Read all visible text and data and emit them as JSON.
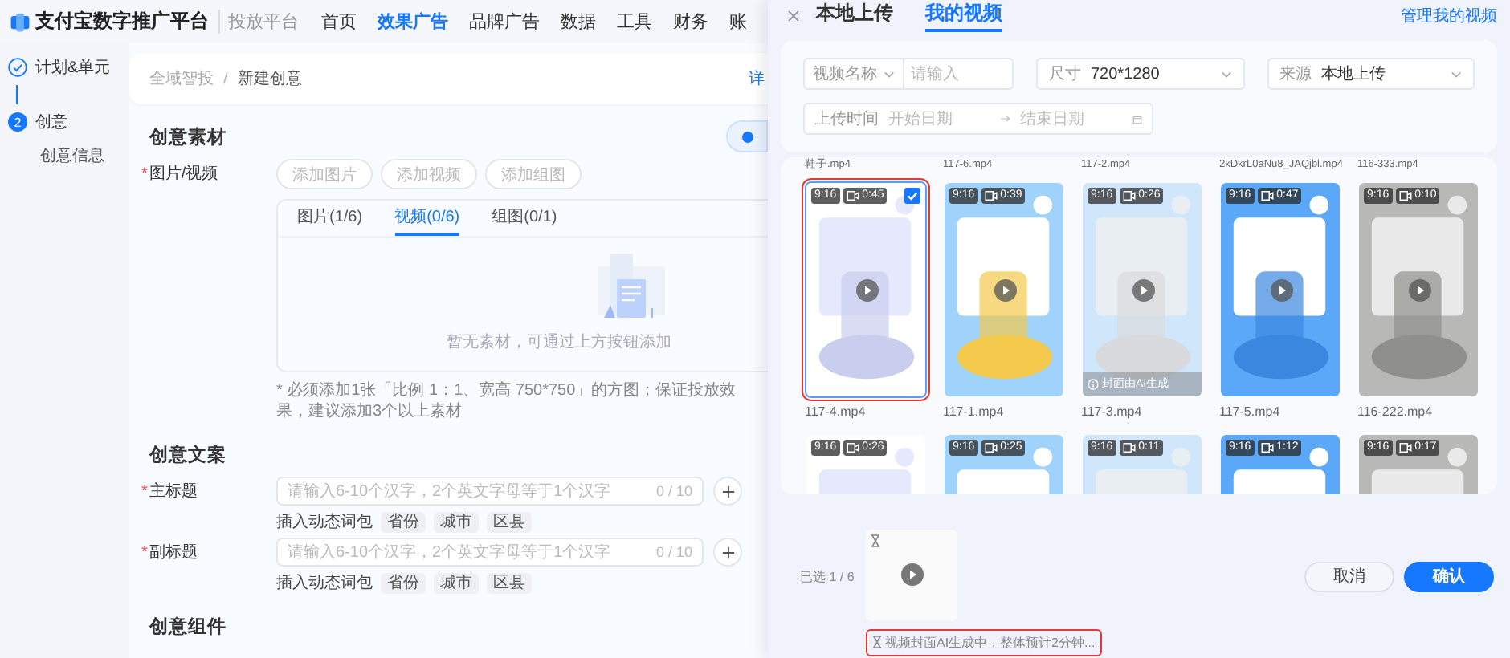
{
  "header": {
    "brand": "支付宝数字推广平台",
    "product": "投放平台",
    "nav": [
      {
        "label": "首页",
        "selected": false
      },
      {
        "label": "效果广告",
        "selected": true
      },
      {
        "label": "品牌广告",
        "selected": false
      },
      {
        "label": "数据",
        "selected": false
      },
      {
        "label": "工具",
        "selected": false
      },
      {
        "label": "财务",
        "selected": false
      },
      {
        "label": "账",
        "selected": false
      }
    ]
  },
  "steps": [
    {
      "label": "计划&单元",
      "done": true
    },
    {
      "number": "2",
      "label": "创意",
      "done": false,
      "children": [
        {
          "label": "创意信息"
        }
      ]
    }
  ],
  "breadcrumb": {
    "items": [
      "全域智投",
      "新建创意"
    ],
    "separator": "/",
    "link": "详"
  },
  "material": {
    "title": "创意素材",
    "label": "图片/视频",
    "required_mark": "*",
    "add_buttons": [
      "添加图片",
      "添加视频",
      "添加组图"
    ],
    "tabs": [
      {
        "label": "图片(1/6)",
        "selected": false
      },
      {
        "label": "视频(0/6)",
        "selected": true
      },
      {
        "label": "组图(0/1)",
        "selected": false
      }
    ],
    "empty_text": "暂无素材，可通过上方按钮添加",
    "note": "* 必须添加1张「比例 1：1、宽高 750*750」的方图；保证投放效果，建议添加3个以上素材"
  },
  "copy": {
    "title": "创意文案",
    "fields": [
      {
        "label": "主标题",
        "required_mark": "*",
        "placeholder": "请输入6-10个汉字，2个英文字母等于1个汉字",
        "counter": "0 / 10",
        "insert_label": "插入动态词包",
        "tags": [
          "省份",
          "城市",
          "区县"
        ]
      },
      {
        "label": "副标题",
        "required_mark": "*",
        "placeholder": "请输入6-10个汉字，2个英文字母等于1个汉字",
        "counter": "0 / 10",
        "insert_label": "插入动态词包",
        "tags": [
          "省份",
          "城市",
          "区县"
        ]
      }
    ]
  },
  "components": {
    "title": "创意组件"
  },
  "drawer": {
    "tabs": [
      {
        "label": "本地上传",
        "selected": false
      },
      {
        "label": "我的视频",
        "selected": true
      }
    ],
    "manage_link": "管理我的视频",
    "filters": {
      "name_select": "视频名称",
      "name_placeholder": "请输入",
      "size_label": "尺寸",
      "size_value": "720*1280",
      "source_label": "来源",
      "source_value": "本地上传",
      "date_label": "上传时间",
      "start_placeholder": "开始日期",
      "end_placeholder": "结束日期"
    },
    "prev_row_names": [
      "鞋子.mp4",
      "117-6.mp4",
      "117-2.mp4",
      "2kDkrL0aNu8_JAQjbl.mp4",
      "116-333.mp4"
    ],
    "videos": [
      {
        "ratio": "9:16",
        "duration": "0:45",
        "name": "117-4.mp4",
        "selected": true,
        "highlighted": true
      },
      {
        "ratio": "9:16",
        "duration": "0:39",
        "name": "117-1.mp4",
        "selected": false,
        "highlighted": false
      },
      {
        "ratio": "9:16",
        "duration": "0:26",
        "name": "117-3.mp4",
        "selected": false,
        "highlighted": false,
        "cover_note": "封面由AI生成"
      },
      {
        "ratio": "9:16",
        "duration": "0:47",
        "name": "117-5.mp4",
        "selected": false,
        "highlighted": false
      },
      {
        "ratio": "9:16",
        "duration": "0:10",
        "name": "116-222.mp4",
        "selected": false,
        "highlighted": false
      },
      {
        "ratio": "9:16",
        "duration": "0:26",
        "selected": false,
        "highlighted": false
      },
      {
        "ratio": "9:16",
        "duration": "0:25",
        "selected": false,
        "highlighted": false
      },
      {
        "ratio": "9:16",
        "duration": "0:11",
        "selected": false,
        "highlighted": false
      },
      {
        "ratio": "9:16",
        "duration": "1:12",
        "selected": false,
        "highlighted": false
      },
      {
        "ratio": "9:16",
        "duration": "0:17",
        "selected": false,
        "highlighted": false
      }
    ],
    "selected_count": "已选 1 / 6",
    "status": {
      "text": "视频封面AI生成中，整体预计2分钟...",
      "highlighted": true
    },
    "buttons": [
      {
        "label": "取消",
        "kind": "secondary"
      },
      {
        "label": "确认",
        "kind": "primary"
      }
    ]
  }
}
